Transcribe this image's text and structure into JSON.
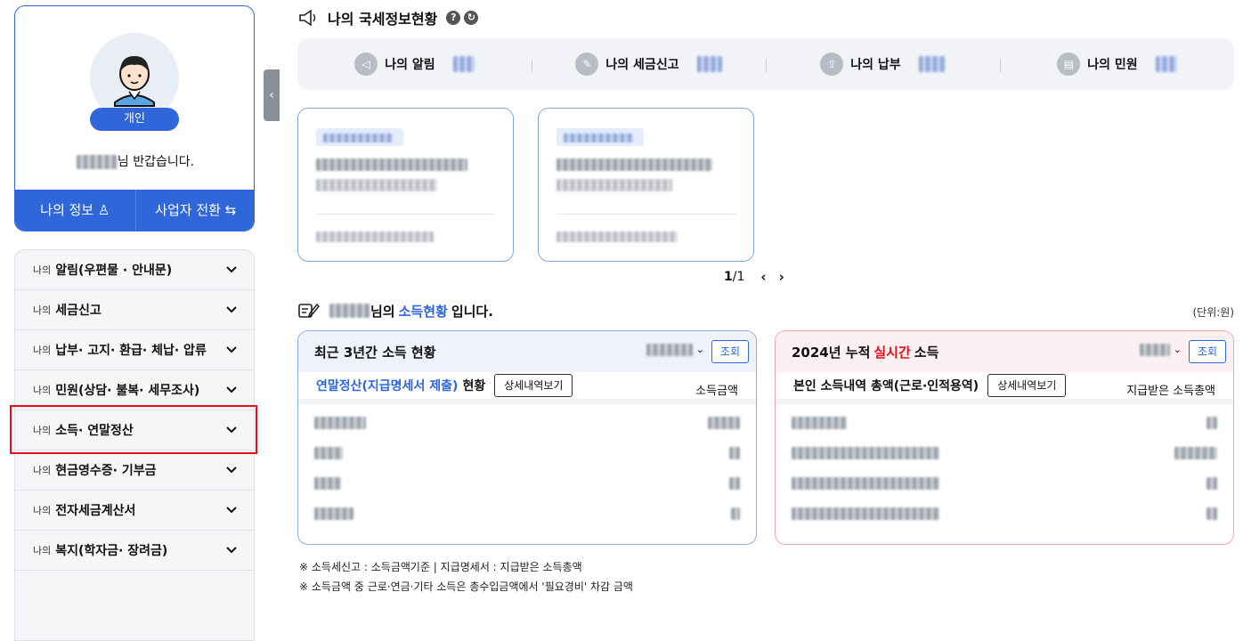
{
  "profile": {
    "badge": "개인",
    "greeting_suffix": "님 반갑습니다.",
    "my_info": "나의 정보",
    "switch_business": "사업자 전환"
  },
  "menu": [
    {
      "prefix": "나의",
      "label": "알림(우편물 · 안내문)"
    },
    {
      "prefix": "나의",
      "label": "세금신고"
    },
    {
      "prefix": "나의",
      "label": "납부· 고지· 환급· 체납· 압류"
    },
    {
      "prefix": "나의",
      "label": "민원(상담· 불복· 세무조사)"
    },
    {
      "prefix": "나의",
      "label": "소득· 연말정산"
    },
    {
      "prefix": "나의",
      "label": "현금영수증· 기부금"
    },
    {
      "prefix": "나의",
      "label": "전자세금계산서"
    },
    {
      "prefix": "나의",
      "label": "복지(학자금· 장려금)"
    }
  ],
  "header": {
    "title": "나의 국세정보현황",
    "help": "?",
    "refresh": "↻"
  },
  "stats": [
    {
      "name": "나의 알림",
      "icon": "megaphone-icon"
    },
    {
      "name": "나의 세금신고",
      "icon": "pencil-icon"
    },
    {
      "name": "나의 납부",
      "icon": "upload-icon"
    },
    {
      "name": "나의 민원",
      "icon": "clipboard-icon"
    }
  ],
  "pager": {
    "current": "1",
    "sep": " / ",
    "total": "1"
  },
  "income": {
    "suffix": "님의",
    "accent": "소득현황",
    "tail": "입니다.",
    "unit": "(단위:원)"
  },
  "left_panel": {
    "title": "최근 3년간 소득 현황",
    "query": "조회",
    "sub_accent": "연말정산(지급명세서 제출)",
    "sub_tail": "현황",
    "detail": "상세내역보기",
    "col": "소득금액"
  },
  "right_panel": {
    "title_pre": "2024년 누적",
    "title_red": "실시간",
    "title_post": "소득",
    "query": "조회",
    "sub": "본인 소득내역 총액(근로·인적용역)",
    "detail": "상세내역보기",
    "col": "지급받은 소득총액"
  },
  "notes": [
    "※ 소득세신고 : 소득금액기준  |  지급명세서 : 지급받은 소득총액",
    "※ 소득금액 중 근로·연금·기타 소득은 총수입금액에서 '필요경비' 차감 금액"
  ],
  "colors": {
    "primary": "#2f66d9",
    "red": "#e3101a",
    "highlight": "#e3101a"
  }
}
